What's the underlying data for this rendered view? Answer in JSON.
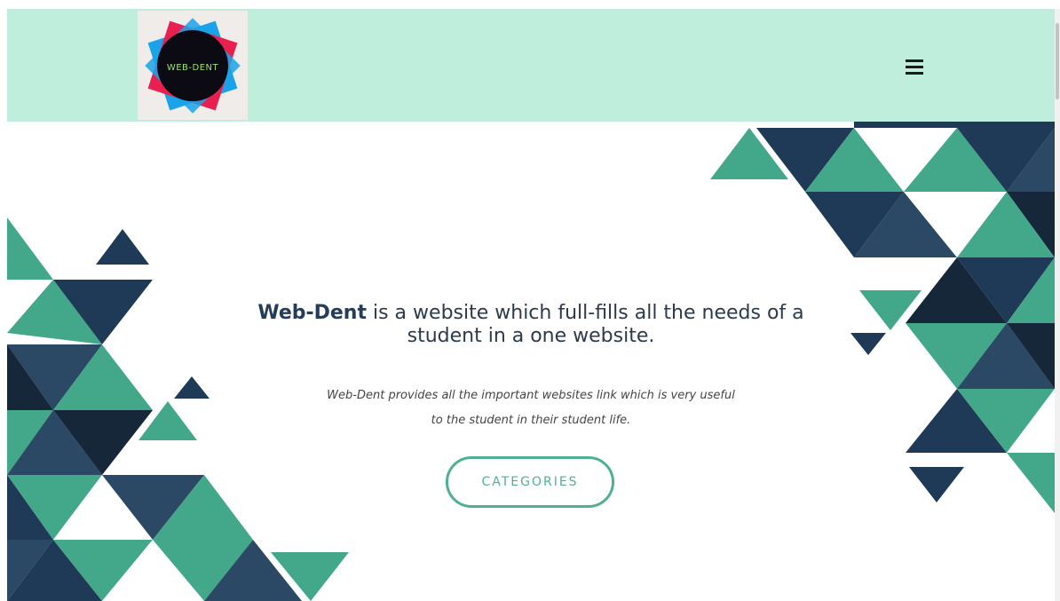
{
  "navbar": {
    "logo_text": "WEB-DENT",
    "menu_icon": "hamburger-menu-icon"
  },
  "hero": {
    "headline_brand": "Web-Dent",
    "headline_rest_1": " is a website which full-fills all the needs of a",
    "headline_rest_2": "student in a one website.",
    "subtext_line_1": "Web-Dent provides all the important websites link which is very useful",
    "subtext_line_2": "to the student in their student life.",
    "cta_label": "CATEGORIES"
  },
  "colors": {
    "navbar_bg": "#bfeedd",
    "navy": "#233d5a",
    "teal": "#4fb093",
    "dark_navy": "#16273a"
  }
}
